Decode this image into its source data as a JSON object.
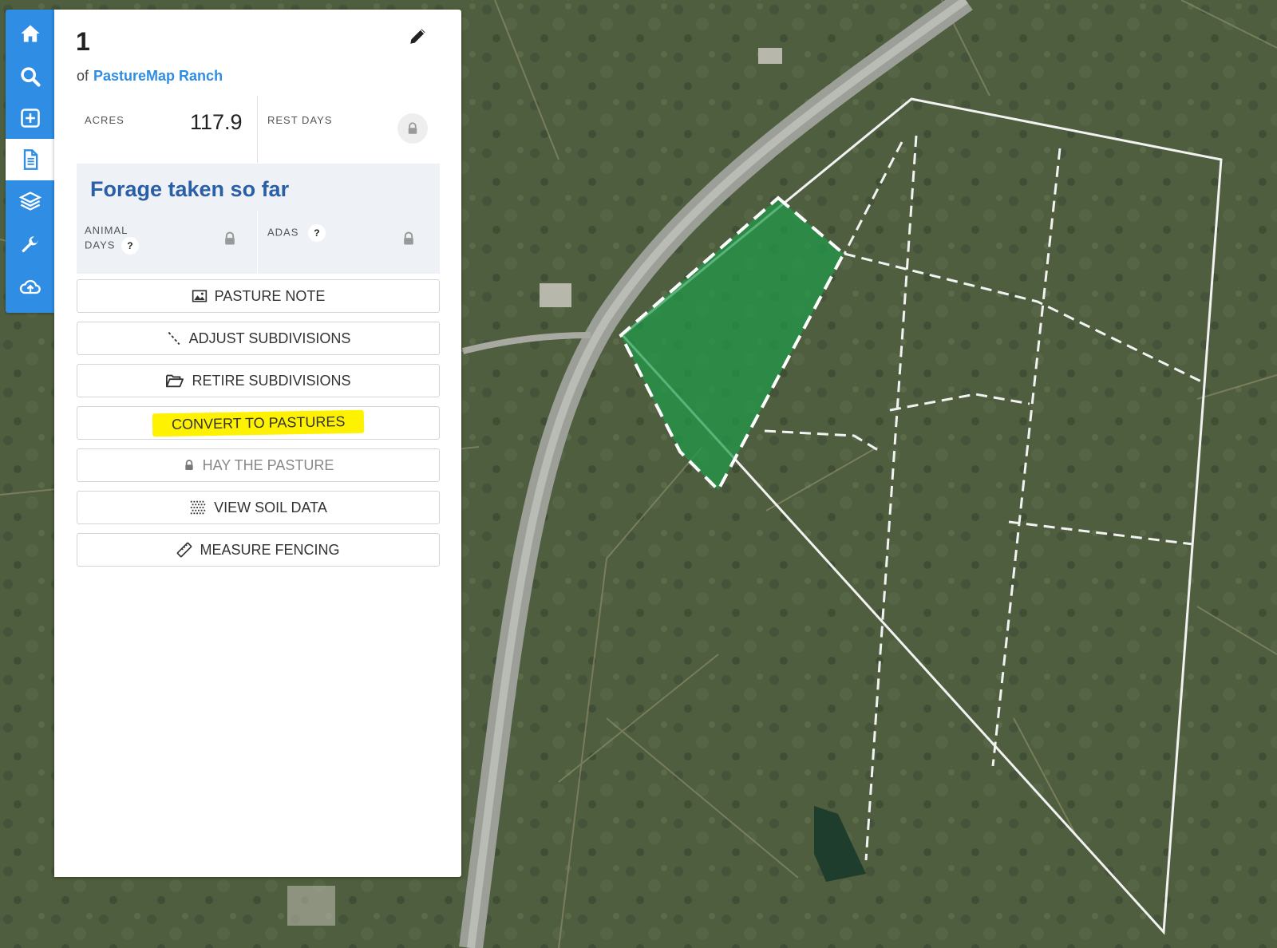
{
  "toolbar": {
    "items": [
      {
        "icon": "home-icon"
      },
      {
        "icon": "search-icon"
      },
      {
        "icon": "add-icon"
      },
      {
        "icon": "document-icon",
        "active": true
      },
      {
        "icon": "layers-icon"
      },
      {
        "icon": "wrench-icon"
      },
      {
        "icon": "cloud-upload-icon"
      }
    ]
  },
  "pasture": {
    "name": "1",
    "of_label": "of",
    "ranch": "PastureMap Ranch",
    "acres_label": "ACRES",
    "acres_value": "117.9",
    "rest_days_label": "REST DAYS"
  },
  "forage": {
    "title": "Forage taken so far",
    "animal_days_line1": "ANIMAL",
    "animal_days_line2": "DAYS",
    "adas_label": "ADAS",
    "help_glyph": "?"
  },
  "actions": {
    "pasture_note": "PASTURE NOTE",
    "adjust_subdivisions": "ADJUST SUBDIVISIONS",
    "retire_subdivisions": "RETIRE SUBDIVISIONS",
    "convert_to_pastures": "CONVERT TO PASTURES",
    "hay_the_pasture": "HAY THE PASTURE",
    "view_soil_data": "VIEW SOIL DATA",
    "measure_fencing": "MEASURE FENCING"
  },
  "colors": {
    "accent": "#2f8de4",
    "forage_title": "#2a5ea7",
    "highlight": "#fff200",
    "selected_pasture": "#1f9a4a"
  }
}
